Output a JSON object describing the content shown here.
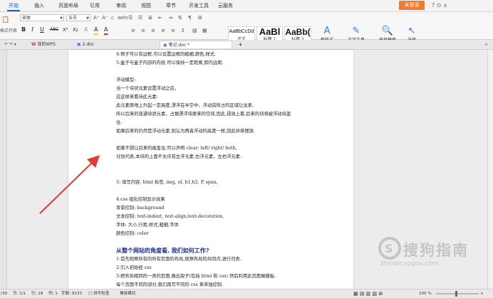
{
  "menubar": {
    "tabs": [
      "开始",
      "插入",
      "页面布局",
      "引用",
      "审阅",
      "视图",
      "章节",
      "开发工具",
      "云服务"
    ],
    "active": "开始",
    "login": "未登录",
    "controls": "? ⊙ ∧"
  },
  "ribbon": {
    "clipboard_label": "格式代表",
    "font_name": "宋体",
    "font_size": "五号",
    "font_glyphs": [
      "A⁺",
      "A⁻",
      "◇",
      "wén"
    ],
    "format_buttons": [
      "B",
      "I",
      "U",
      "ABC",
      "X²",
      "X₂",
      "A",
      "A",
      "A"
    ],
    "para_glyphs": [
      "☰",
      "☰",
      "≣",
      "⇤",
      "⇥",
      "⇅",
      "¶",
      "⊞"
    ],
    "styles": [
      {
        "preview": "AaBbCcDd",
        "caption": "正文"
      },
      {
        "preview": "AaBl",
        "caption": "标题 1"
      },
      {
        "preview": "AaBb(",
        "caption": "标题 2"
      }
    ],
    "new_style": "新样式",
    "text_tools": "文字工具",
    "find_replace": "查找替换",
    "select": "选择"
  },
  "tabbar": {
    "quick": "↶ ↷ ▾",
    "tabs": [
      {
        "label": "我的WPS"
      },
      {
        "label": "2.doc"
      },
      {
        "label": "笔记.doc *"
      }
    ],
    "add": "+"
  },
  "document": {
    "lines": [
      "4:例子可以有边框,可以设置边框的粗细,颜色,样式.",
      "5:盒子与盒子内部的内容,可以保持一定距离,即内边距.",
      "",
      "浮动模型:",
      "当一个块状元素设置浮动之后，",
      "应这样来看待此元素:",
      "此元素原地上升起一定高度,漂浮在半空中，浮动前所占的区域让出来.",
      "所以后来的普通块状元素，占据漂浮块原来的空间,因此,视效上看,后来的块将被浮动块盖",
      "住.",
      "如果后来的仍然是浮动元素,则认为两者浮动的高度一样,因此并排摆放.",
      "",
      "如果不想让后来的被盖住,可以声明  clear: left/ right/ both,",
      "分别代表,本块的上面不允许有左浮元素,右浮元素，左右浮元素.",
      "",
      "",
      "",
      "3:  填写内容, html 标签, img, ul, h1,h2, P, span,",
      "",
      "4:css 组化控制显示效果",
      "背景控制: background",
      "文本控制: text-indent, text-align,text-decoration,",
      "字体: 大小,行距,样式,粗细,字体",
      "颜色控制: color"
    ],
    "heading": "从整个网站的角度看, 我们如何工作?",
    "after": [
      "1:首先观察所有的所有页面的布局,观察布局的共同点,进行归类.",
      "2:引入初始经 css",
      "3:把布局相同的一类的页面,做出架子(包括 html 和 css)  然后利用此页面做模板.",
      "每个页面不同的部分,我们再写不同的 css 来单独控制."
    ]
  },
  "statusbar": {
    "items": [
      "/39",
      "节: 1/1",
      "行: 18",
      "列: 1",
      "字数: 9133",
      "□ 拼写检查",
      "兼容模式"
    ],
    "view_icons": "▦ ▤ ▥ ▧ ⊞",
    "zoom": "100 %"
  },
  "watermark": {
    "title": "搜狗指南",
    "url": "zhinan.sogou.com"
  },
  "colors": {
    "accent": "#1f5fb0",
    "login": "#f07a2d",
    "heading": "#1a2f8a",
    "arrow": "#e53935"
  }
}
